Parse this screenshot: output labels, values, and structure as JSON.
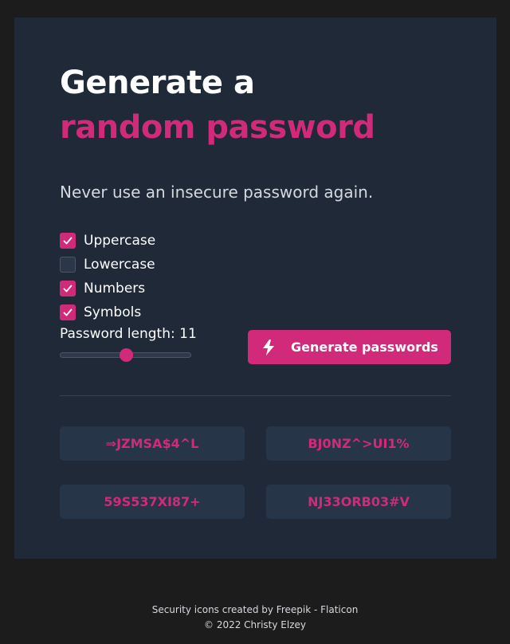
{
  "header": {
    "title_line1": "Generate a",
    "title_line2": "random password",
    "subtitle": "Never use an insecure password again."
  },
  "options": [
    {
      "label": "Uppercase",
      "checked": true
    },
    {
      "label": "Lowercase",
      "checked": false
    },
    {
      "label": "Numbers",
      "checked": true
    },
    {
      "label": "Symbols",
      "checked": true
    }
  ],
  "length": {
    "label": "Password length: 11",
    "value": 11,
    "min": 6,
    "max": 16
  },
  "generate_button": {
    "label": "Generate passwords",
    "icon": "bolt-icon"
  },
  "passwords": [
    "⇒JZMSA$4^L",
    "BJ0NZ^>UI1%",
    "59S537XI87+",
    "NJ33ORB03#V"
  ],
  "footer": {
    "credit_prefix": "Security icons created by ",
    "credit_link": "Freepik - Flaticon",
    "copyright": "© 2022 Christy Elzey"
  },
  "colors": {
    "accent": "#d12a7a",
    "card": "#1f2937",
    "background": "#1c1c1c",
    "password_bg": "#273549"
  }
}
